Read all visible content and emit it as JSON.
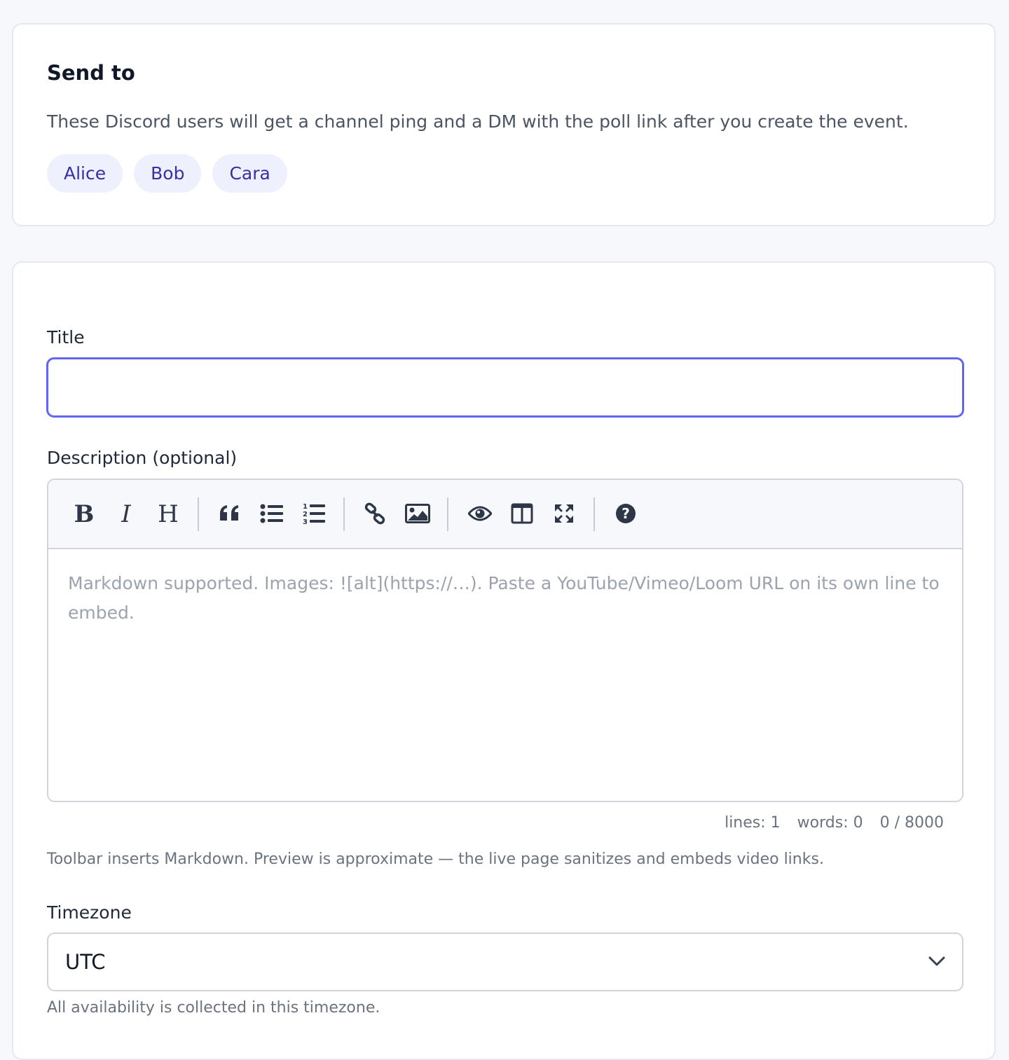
{
  "send_to": {
    "title": "Send to",
    "description": "These Discord users will get a channel ping and a DM with the poll link after you create the event.",
    "recipients": [
      "Alice",
      "Bob",
      "Cara"
    ]
  },
  "form": {
    "title_label": "Title",
    "title_value": "",
    "description_label": "Description (optional)",
    "editor": {
      "toolbar_icons": [
        "bold-icon",
        "italic-icon",
        "heading-icon",
        "quote-icon",
        "unordered-list-icon",
        "ordered-list-icon",
        "link-icon",
        "image-icon",
        "preview-icon",
        "side-by-side-icon",
        "fullscreen-icon",
        "help-icon"
      ],
      "placeholder": "Markdown supported. Images: ![alt](https://…). Paste a YouTube/Vimeo/Loom URL on its own line to embed.",
      "status": {
        "lines": "lines: 1",
        "words": "words: 0",
        "chars": "0 / 8000"
      }
    },
    "editor_help": "Toolbar inserts Markdown. Preview is approximate — the live page sanitizes and embeds video links.",
    "timezone_label": "Timezone",
    "timezone_value": "UTC",
    "timezone_help": "All availability is collected in this timezone."
  },
  "colors": {
    "accent": "#6366f1",
    "chip_bg": "#eef0fd",
    "chip_text": "#3730a3",
    "page_bg": "#f7f8fb"
  }
}
